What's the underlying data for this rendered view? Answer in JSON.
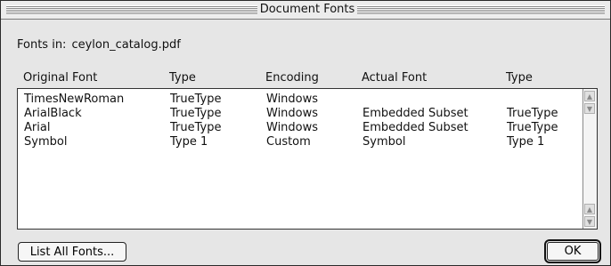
{
  "window": {
    "title": "Document Fonts"
  },
  "fonts_in": {
    "label": "Fonts in:",
    "file": "ceylon_catalog.pdf"
  },
  "columns": [
    "Original Font",
    "Type",
    "Encoding",
    "Actual Font",
    "Type"
  ],
  "rows": [
    [
      "TimesNewRoman",
      "TrueType",
      "Windows",
      "",
      ""
    ],
    [
      "ArialBlack",
      "TrueType",
      "Windows",
      "Embedded Subset",
      "TrueType"
    ],
    [
      "Arial",
      "TrueType",
      "Windows",
      "Embedded Subset",
      "TrueType"
    ],
    [
      "Symbol",
      "Type 1",
      "Custom",
      "Symbol",
      "Type 1"
    ]
  ],
  "buttons": {
    "list_all": "List All Fonts...",
    "ok": "OK"
  },
  "icons": {
    "scroll_up": "scroll-up-arrow-icon",
    "scroll_down": "scroll-down-arrow-icon"
  }
}
